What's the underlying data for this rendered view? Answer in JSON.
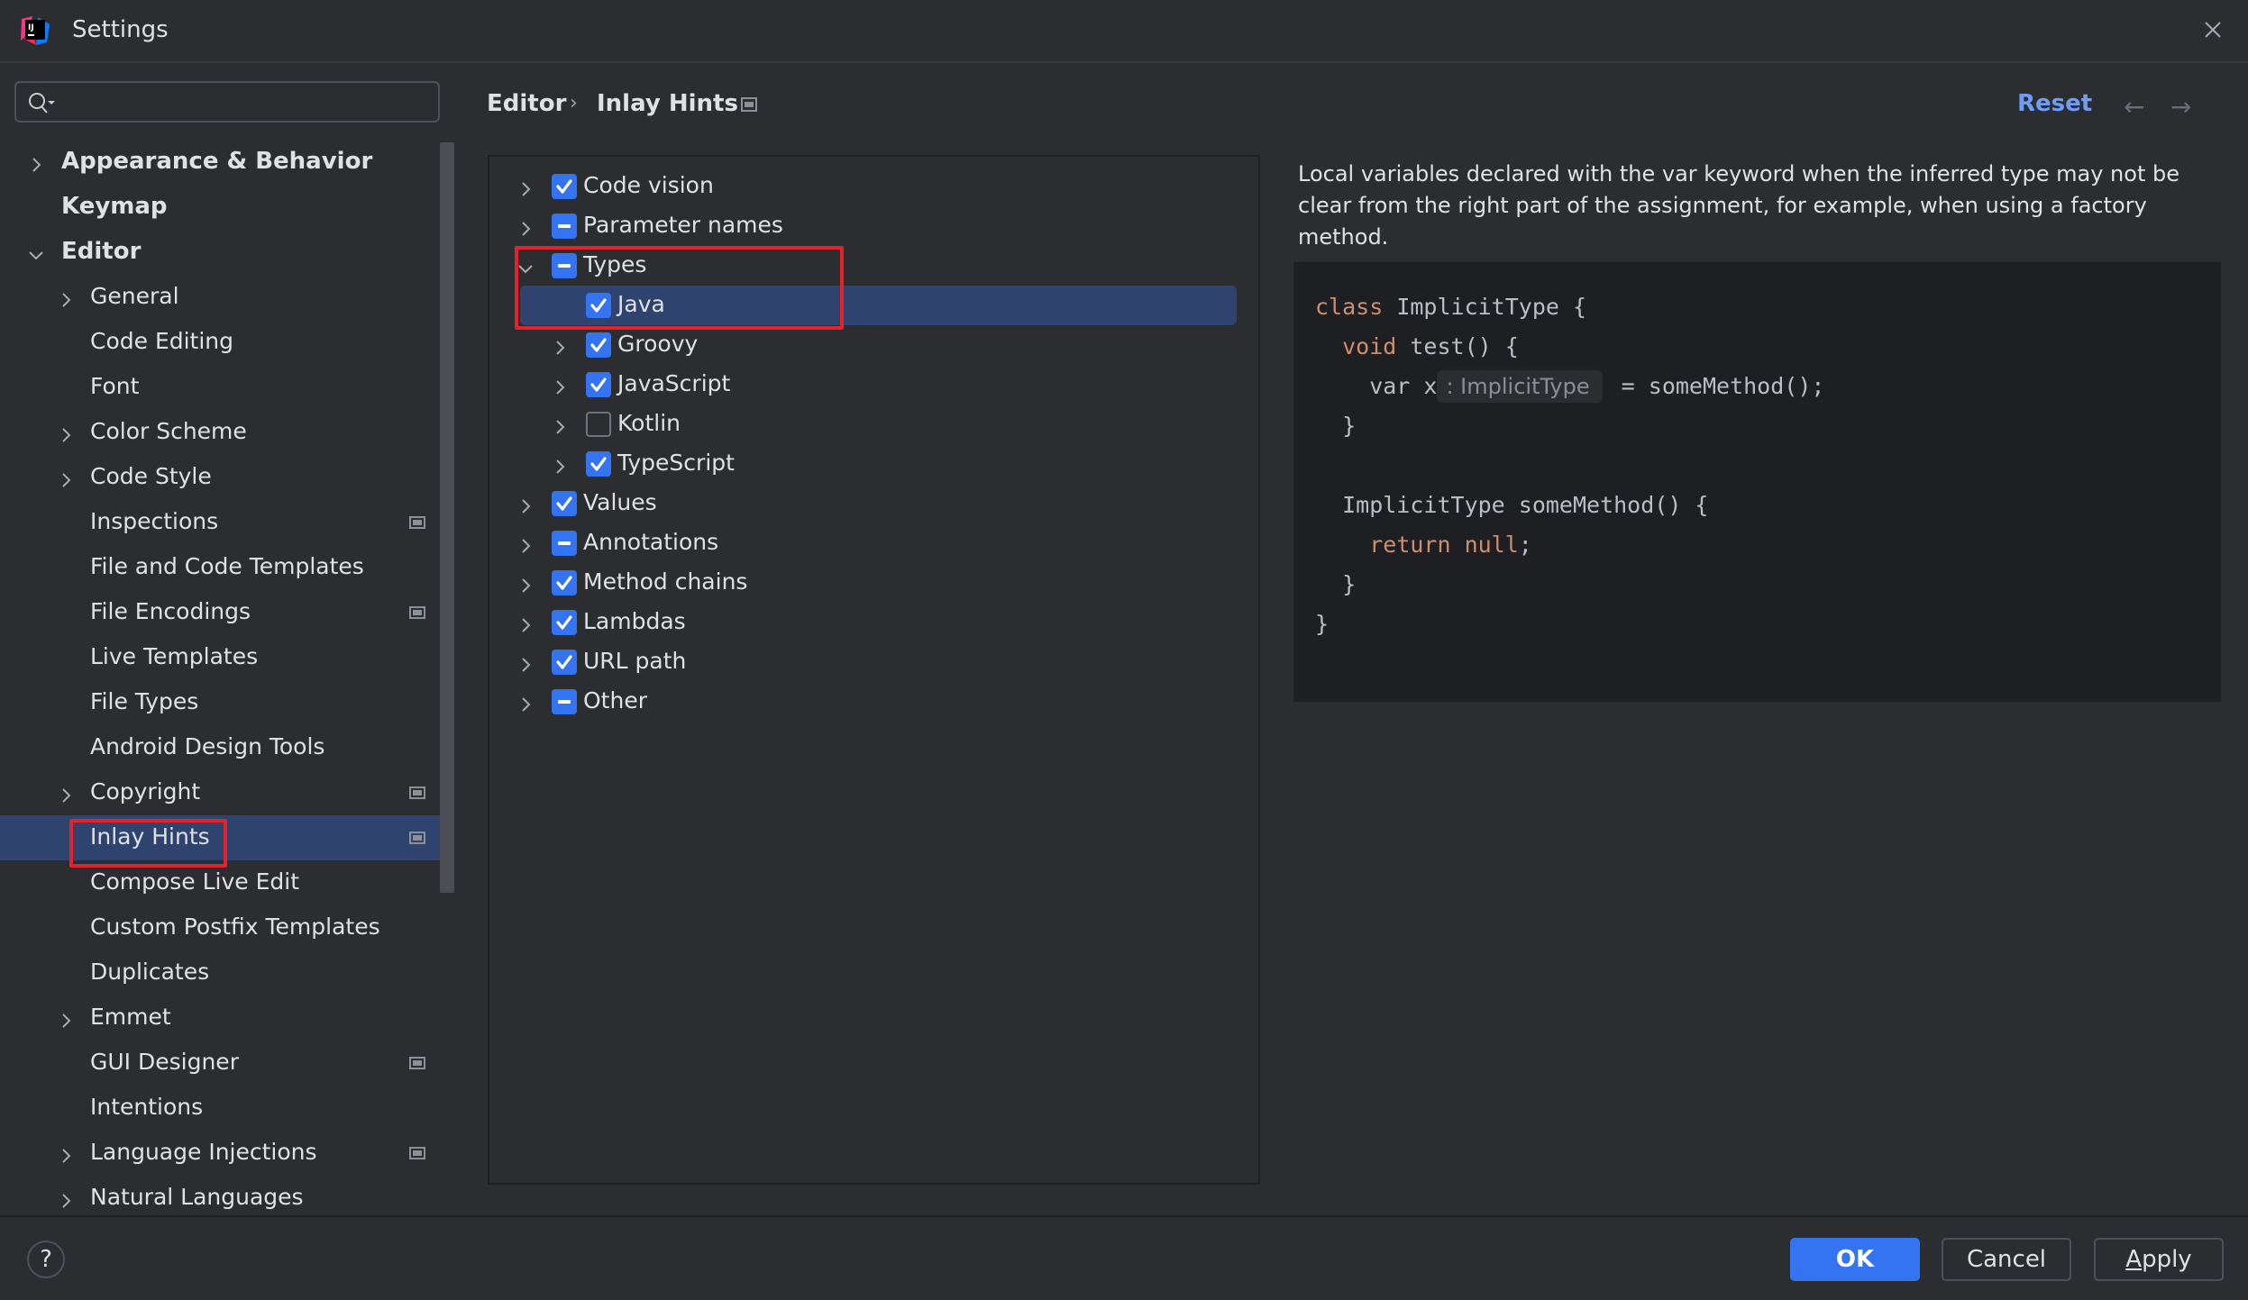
{
  "window": {
    "title": "Settings",
    "app_icon": "intellij-logo-icon",
    "close_icon": "close-icon"
  },
  "search": {
    "placeholder": "",
    "value": "",
    "icon": "search-icon"
  },
  "sidebar": {
    "items": [
      {
        "label": "Appearance & Behavior",
        "level": 0,
        "bold": true,
        "chevron": "right",
        "project_icon": false,
        "selected": false
      },
      {
        "label": "Keymap",
        "level": 0,
        "bold": true,
        "chevron": "none",
        "project_icon": false,
        "selected": false
      },
      {
        "label": "Editor",
        "level": 0,
        "bold": true,
        "chevron": "down",
        "project_icon": false,
        "selected": false
      },
      {
        "label": "General",
        "level": 1,
        "bold": false,
        "chevron": "right",
        "project_icon": false,
        "selected": false
      },
      {
        "label": "Code Editing",
        "level": 1,
        "bold": false,
        "chevron": "none",
        "project_icon": false,
        "selected": false
      },
      {
        "label": "Font",
        "level": 1,
        "bold": false,
        "chevron": "none",
        "project_icon": false,
        "selected": false
      },
      {
        "label": "Color Scheme",
        "level": 1,
        "bold": false,
        "chevron": "right",
        "project_icon": false,
        "selected": false
      },
      {
        "label": "Code Style",
        "level": 1,
        "bold": false,
        "chevron": "right",
        "project_icon": false,
        "selected": false
      },
      {
        "label": "Inspections",
        "level": 1,
        "bold": false,
        "chevron": "none",
        "project_icon": true,
        "selected": false
      },
      {
        "label": "File and Code Templates",
        "level": 1,
        "bold": false,
        "chevron": "none",
        "project_icon": false,
        "selected": false
      },
      {
        "label": "File Encodings",
        "level": 1,
        "bold": false,
        "chevron": "none",
        "project_icon": true,
        "selected": false
      },
      {
        "label": "Live Templates",
        "level": 1,
        "bold": false,
        "chevron": "none",
        "project_icon": false,
        "selected": false
      },
      {
        "label": "File Types",
        "level": 1,
        "bold": false,
        "chevron": "none",
        "project_icon": false,
        "selected": false
      },
      {
        "label": "Android Design Tools",
        "level": 1,
        "bold": false,
        "chevron": "none",
        "project_icon": false,
        "selected": false
      },
      {
        "label": "Copyright",
        "level": 1,
        "bold": false,
        "chevron": "right",
        "project_icon": true,
        "selected": false
      },
      {
        "label": "Inlay Hints",
        "level": 1,
        "bold": false,
        "chevron": "none",
        "project_icon": true,
        "selected": true
      },
      {
        "label": "Compose Live Edit",
        "level": 1,
        "bold": false,
        "chevron": "none",
        "project_icon": false,
        "selected": false
      },
      {
        "label": "Custom Postfix Templates",
        "level": 1,
        "bold": false,
        "chevron": "none",
        "project_icon": false,
        "selected": false
      },
      {
        "label": "Duplicates",
        "level": 1,
        "bold": false,
        "chevron": "none",
        "project_icon": false,
        "selected": false
      },
      {
        "label": "Emmet",
        "level": 1,
        "bold": false,
        "chevron": "right",
        "project_icon": false,
        "selected": false
      },
      {
        "label": "GUI Designer",
        "level": 1,
        "bold": false,
        "chevron": "none",
        "project_icon": true,
        "selected": false
      },
      {
        "label": "Intentions",
        "level": 1,
        "bold": false,
        "chevron": "none",
        "project_icon": false,
        "selected": false
      },
      {
        "label": "Language Injections",
        "level": 1,
        "bold": false,
        "chevron": "right",
        "project_icon": true,
        "selected": false
      },
      {
        "label": "Natural Languages",
        "level": 1,
        "bold": false,
        "chevron": "right",
        "project_icon": false,
        "selected": false
      }
    ]
  },
  "breadcrumb": {
    "parent": "Editor",
    "separator": "›",
    "current": "Inlay Hints"
  },
  "header_actions": {
    "reset_label": "Reset",
    "back_arrow": "←",
    "forward_arrow": "→"
  },
  "hints_tree": {
    "items": [
      {
        "label": "Code vision",
        "level": 0,
        "state": "checked",
        "chevron": "right",
        "selected": false
      },
      {
        "label": "Parameter names",
        "level": 0,
        "state": "partial",
        "chevron": "right",
        "selected": false
      },
      {
        "label": "Types",
        "level": 0,
        "state": "partial",
        "chevron": "down",
        "selected": false
      },
      {
        "label": "Java",
        "level": 1,
        "state": "checked",
        "chevron": "none",
        "selected": true
      },
      {
        "label": "Groovy",
        "level": 1,
        "state": "checked",
        "chevron": "right",
        "selected": false
      },
      {
        "label": "JavaScript",
        "level": 1,
        "state": "checked",
        "chevron": "right",
        "selected": false
      },
      {
        "label": "Kotlin",
        "level": 1,
        "state": "unchecked",
        "chevron": "right",
        "selected": false
      },
      {
        "label": "TypeScript",
        "level": 1,
        "state": "checked",
        "chevron": "right",
        "selected": false
      },
      {
        "label": "Values",
        "level": 0,
        "state": "checked",
        "chevron": "right",
        "selected": false
      },
      {
        "label": "Annotations",
        "level": 0,
        "state": "partial",
        "chevron": "right",
        "selected": false
      },
      {
        "label": "Method chains",
        "level": 0,
        "state": "checked",
        "chevron": "right",
        "selected": false
      },
      {
        "label": "Lambdas",
        "level": 0,
        "state": "checked",
        "chevron": "right",
        "selected": false
      },
      {
        "label": "URL path",
        "level": 0,
        "state": "checked",
        "chevron": "right",
        "selected": false
      },
      {
        "label": "Other",
        "level": 0,
        "state": "partial",
        "chevron": "right",
        "selected": false
      }
    ]
  },
  "description": "Local variables declared with the var keyword when the inferred type may not be clear from the right part of the assignment, for example, when using a factory method.",
  "code_preview": {
    "lines": [
      [
        {
          "t": "class",
          "k": true
        },
        {
          "t": " ImplicitType {"
        }
      ],
      [
        {
          "t": "  "
        },
        {
          "t": "void",
          "k": true
        },
        {
          "t": " test() {"
        }
      ],
      [
        {
          "t": "    var x"
        },
        {
          "hint": ": ImplicitType"
        },
        {
          "t": " = someMethod();"
        }
      ],
      [
        {
          "t": "  }"
        }
      ],
      [
        {
          "t": ""
        }
      ],
      [
        {
          "t": "  ImplicitType someMethod() {"
        }
      ],
      [
        {
          "t": "    "
        },
        {
          "t": "return null",
          "k": true
        },
        {
          "t": ";"
        }
      ],
      [
        {
          "t": "  }"
        }
      ],
      [
        {
          "t": "}"
        }
      ]
    ]
  },
  "footer": {
    "help_label": "?",
    "ok_label": "OK",
    "cancel_label": "Cancel",
    "apply_mnemonic": "A",
    "apply_rest": "pply"
  },
  "colors": {
    "accent": "#3574f0",
    "selection": "#2e436e",
    "highlight_box": "#e3222b",
    "link": "#6f9cf5",
    "keyword": "#cf8e6d"
  }
}
